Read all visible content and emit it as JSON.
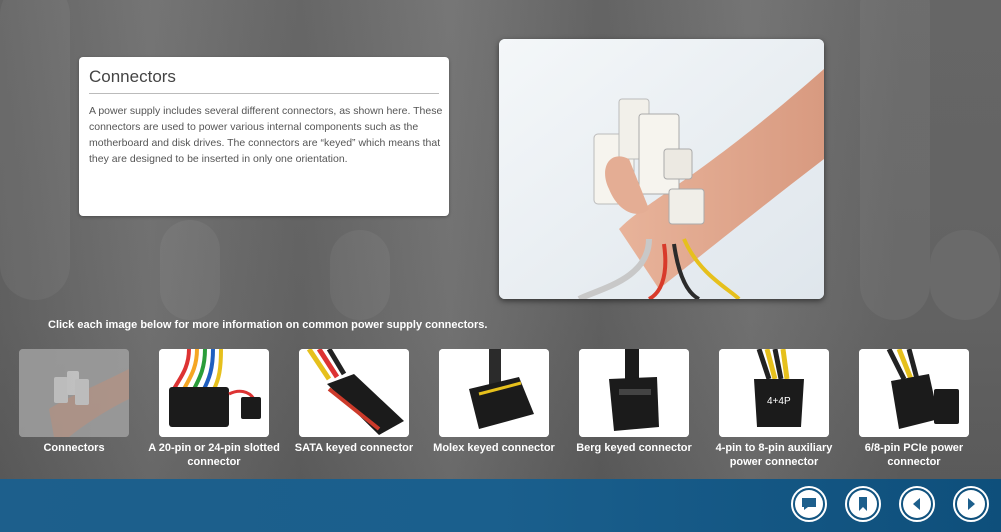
{
  "info": {
    "title": "Connectors",
    "body": "A power supply includes several different connectors, as shown here. These connectors are used to power various internal components such as the motherboard and disk drives. The connectors are “keyed” which means that they are designed to be inserted in only one orientation."
  },
  "instruction": "Click each image below for more information on common power supply connectors.",
  "thumbnails": [
    {
      "label": "Connectors",
      "icon": "hand-connectors-image"
    },
    {
      "label": "A 20-pin or 24-pin slotted connector",
      "icon": "atx-connector-image"
    },
    {
      "label": "SATA keyed connector",
      "icon": "sata-connector-image"
    },
    {
      "label": "Molex keyed connector",
      "icon": "molex-connector-image"
    },
    {
      "label": "Berg keyed connector",
      "icon": "berg-connector-image"
    },
    {
      "label": "4-pin to 8-pin auxiliary power connector",
      "icon": "aux-connector-image"
    },
    {
      "label": "6/8-pin PCIe power connector",
      "icon": "pcie-connector-image"
    }
  ],
  "nav": {
    "buttons": [
      "comment-icon",
      "bookmark-icon",
      "previous-icon",
      "next-icon"
    ]
  },
  "colors": {
    "footer": "#1d5f8c",
    "background": "#6d6d6d"
  }
}
